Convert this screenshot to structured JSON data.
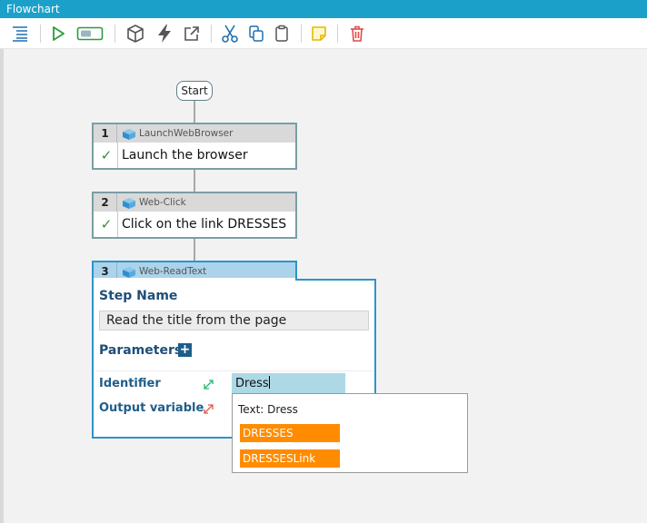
{
  "window": {
    "title": "Flowchart"
  },
  "toolbar": {
    "icons": [
      "list-icon",
      "play-icon",
      "toggle-icon",
      "package-icon",
      "lightning-icon",
      "external-link-icon",
      "scissors-icon",
      "copy-icon",
      "clipboard-icon",
      "note-icon",
      "trash-icon"
    ]
  },
  "flow": {
    "start_label": "Start",
    "steps": [
      {
        "number": "1",
        "type": "LaunchWebBrowser",
        "description": "Launch the browser"
      },
      {
        "number": "2",
        "type": "Web-Click",
        "description": "Click on the link DRESSES"
      },
      {
        "number": "3",
        "type": "Web-ReadText"
      }
    ]
  },
  "editor": {
    "step_name_heading": "Step Name",
    "step_name_value": "Read the title from the page",
    "parameters_heading": "Parameters",
    "add_parameter_label": "+",
    "identifier_label": "Identifier",
    "identifier_value": "Dress",
    "output_variable_label": "Output variable"
  },
  "autocomplete": {
    "label": "Text: Dress",
    "options": [
      "DRESSES",
      "DRESSESLink"
    ]
  },
  "colors": {
    "titlebar": "#1ba1c9",
    "accent": "#2f93c8",
    "selected_header": "#abd3ea",
    "suggestion": "#ff8c00",
    "check": "#3b8a3a",
    "heading": "#1f4e79"
  }
}
